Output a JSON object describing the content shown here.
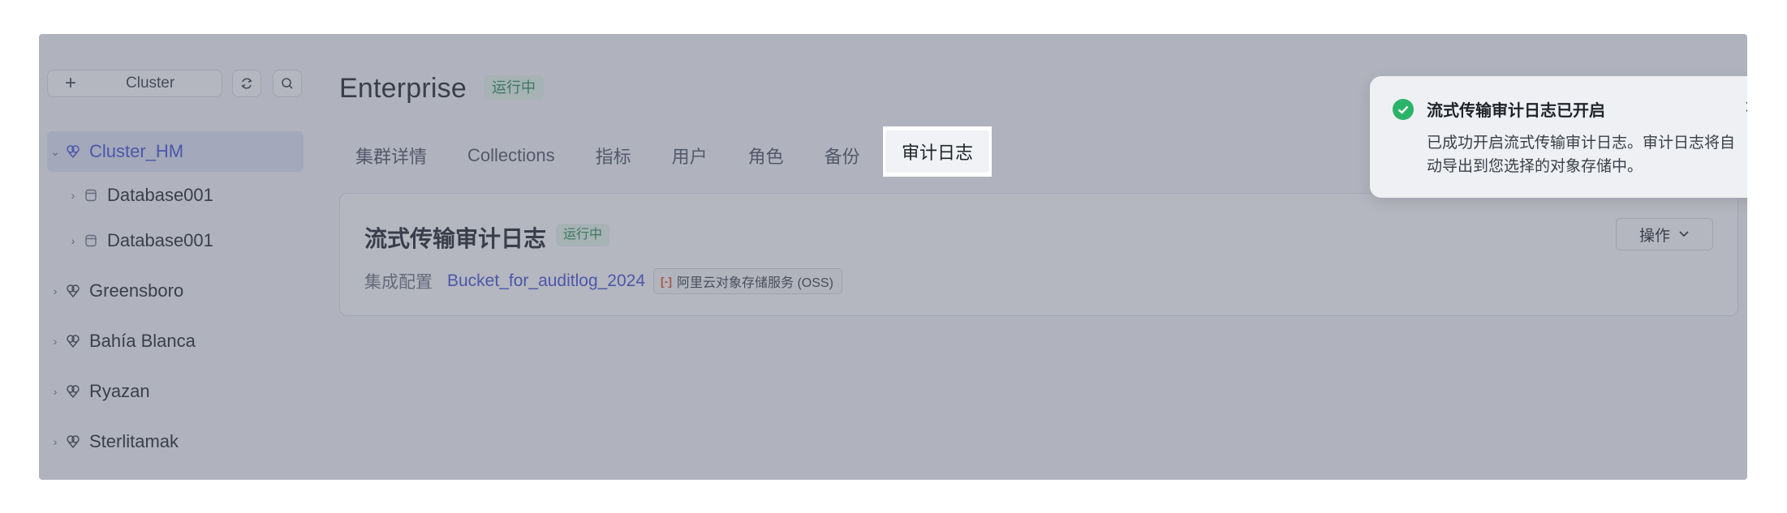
{
  "sidebar": {
    "add_button": {
      "icon": "plus-icon",
      "label": "Cluster"
    },
    "refresh_icon": "refresh-icon",
    "search_icon": "search-icon",
    "tree": [
      {
        "label": "Cluster_HM",
        "type": "cluster",
        "expanded": true,
        "selected": true
      },
      {
        "label": "Database001",
        "type": "database"
      },
      {
        "label": "Database001",
        "type": "database"
      },
      {
        "label": "Greensboro",
        "type": "cluster"
      },
      {
        "label": "Bahía Blanca",
        "type": "cluster"
      },
      {
        "label": "Ryazan",
        "type": "cluster"
      },
      {
        "label": "Sterlitamak",
        "type": "cluster"
      }
    ]
  },
  "header": {
    "title": "Enterprise",
    "status": "运行中"
  },
  "tabs": [
    {
      "label": "集群详情"
    },
    {
      "label": "Collections"
    },
    {
      "label": "指标"
    },
    {
      "label": "用户"
    },
    {
      "label": "角色"
    },
    {
      "label": "备份"
    },
    {
      "label": "审计日志",
      "active": true
    }
  ],
  "card": {
    "title": "流式传输审计日志",
    "status": "运行中",
    "config_label": "集成配置",
    "bucket": "Bucket_for_auditlog_2024",
    "provider": "阿里云对象存储服务 (OSS)",
    "actions_label": "操作"
  },
  "toast": {
    "title": "流式传输审计日志已开启",
    "body": "已成功开启流式传输审计日志。审计日志将自动导出到您选择的对象存储中。",
    "close": "×"
  },
  "colors": {
    "accent": "#3f51d8",
    "status_green": "#1f8f4e",
    "status_bg": "#e6f6ec",
    "overlay": "rgba(90,96,116,0.45)"
  }
}
